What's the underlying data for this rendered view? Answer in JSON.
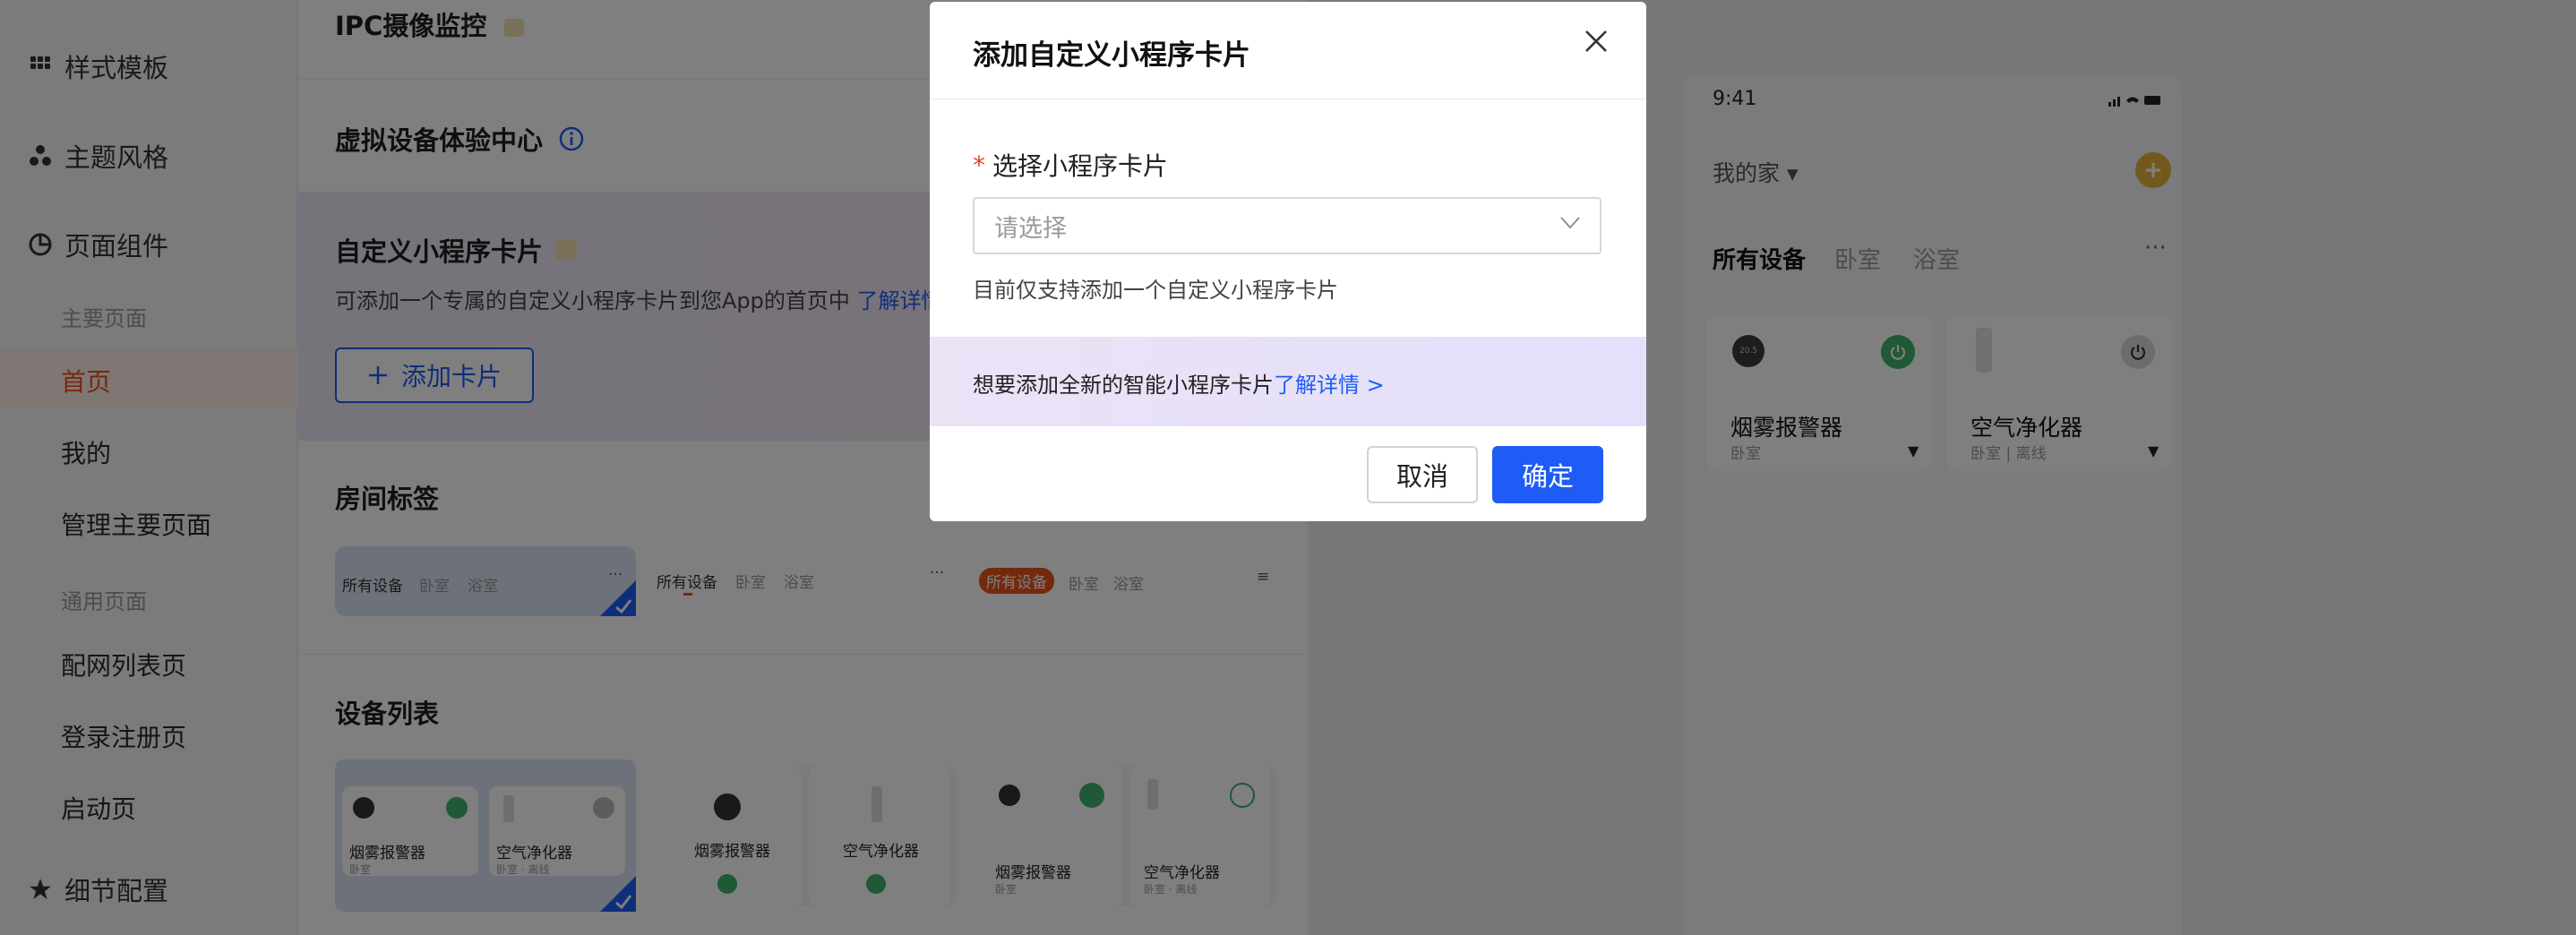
{
  "sidebar": {
    "items": [
      {
        "label": "样式模板",
        "icon": "grid-icon"
      },
      {
        "label": "主题风格",
        "icon": "theme-icon"
      },
      {
        "label": "页面组件",
        "icon": "component-icon"
      }
    ],
    "main_group": "主要页面",
    "main_pages": [
      "首页",
      "我的",
      "管理主要页面"
    ],
    "common_group": "通用页面",
    "common_pages": [
      "配网列表页",
      "登录注册页",
      "启动页"
    ],
    "detail_config": "细节配置"
  },
  "main": {
    "ipc_title": "IPC摄像监控",
    "virtual_title": "虚拟设备体验中心",
    "custom_title": "自定义小程序卡片",
    "custom_desc": "可添加一个专属的自定义小程序卡片到您App的首页中",
    "custom_link": "了解详情",
    "add_card": "添加卡片",
    "room_title": "房间标签",
    "room_tabs": [
      "所有设备",
      "卧室",
      "浴室"
    ],
    "device_title": "设备列表",
    "devices": [
      {
        "name": "烟雾报警器",
        "sub": "卧室"
      },
      {
        "name": "空气净化器",
        "sub": "卧室 · 离线"
      }
    ],
    "thumb_temp": "20.5"
  },
  "phone": {
    "time": "9:41",
    "home": "我的家",
    "tabs": [
      "所有设备",
      "卧室",
      "浴室"
    ],
    "devices": [
      {
        "name": "烟雾报警器",
        "sub": "卧室"
      },
      {
        "name": "空气净化器",
        "sub": "卧室 | 离线"
      }
    ],
    "temp": "20.5"
  },
  "modal": {
    "title": "添加自定义小程序卡片",
    "required_mark": "*",
    "field_label": "选择小程序卡片",
    "placeholder": "请选择",
    "hint": "目前仅支持添加一个自定义小程序卡片",
    "banner_text": "想要添加全新的智能小程序卡片",
    "banner_link": "了解详情 >",
    "cancel": "取消",
    "confirm": "确定"
  },
  "colors": {
    "primary": "#1f5cf5",
    "accent_orange": "#e8531c",
    "required": "#e6422e",
    "power_green": "#3fb36b",
    "gold": "#e8b23a"
  }
}
